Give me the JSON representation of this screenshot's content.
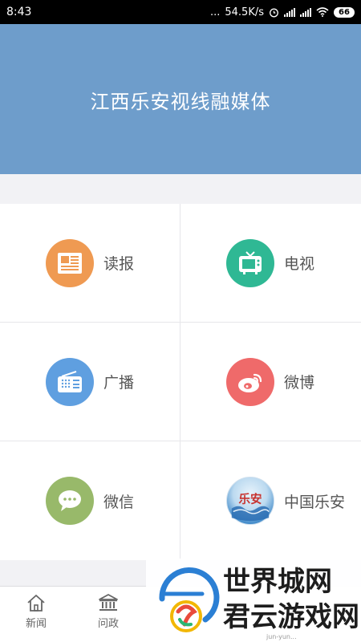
{
  "status_bar": {
    "time": "8:43",
    "dots": "...",
    "speed": "54.5K/s",
    "battery": "66"
  },
  "header": {
    "title": "江西乐安视线融媒体"
  },
  "grid": {
    "items": [
      {
        "label": "读报",
        "icon": "newspaper-icon",
        "color": "#ef9a52"
      },
      {
        "label": "电视",
        "icon": "tv-icon",
        "color": "#2fb894"
      },
      {
        "label": "广播",
        "icon": "radio-icon",
        "color": "#5f9fe0"
      },
      {
        "label": "微博",
        "icon": "weibo-icon",
        "color": "#ef6a6a"
      },
      {
        "label": "微信",
        "icon": "wechat-icon",
        "color": "#98b96a"
      },
      {
        "label": "中国乐安",
        "icon": "lean-logo-icon",
        "color": "#3a86c8",
        "logo_text": "乐安"
      }
    ]
  },
  "bottom_nav": {
    "items": [
      {
        "label": "新闻",
        "icon": "home-icon"
      },
      {
        "label": "问政",
        "icon": "government-icon"
      }
    ]
  },
  "watermark": {
    "line1": "世界城网",
    "line2": "君云游戏网",
    "url": "jun-yun..."
  }
}
